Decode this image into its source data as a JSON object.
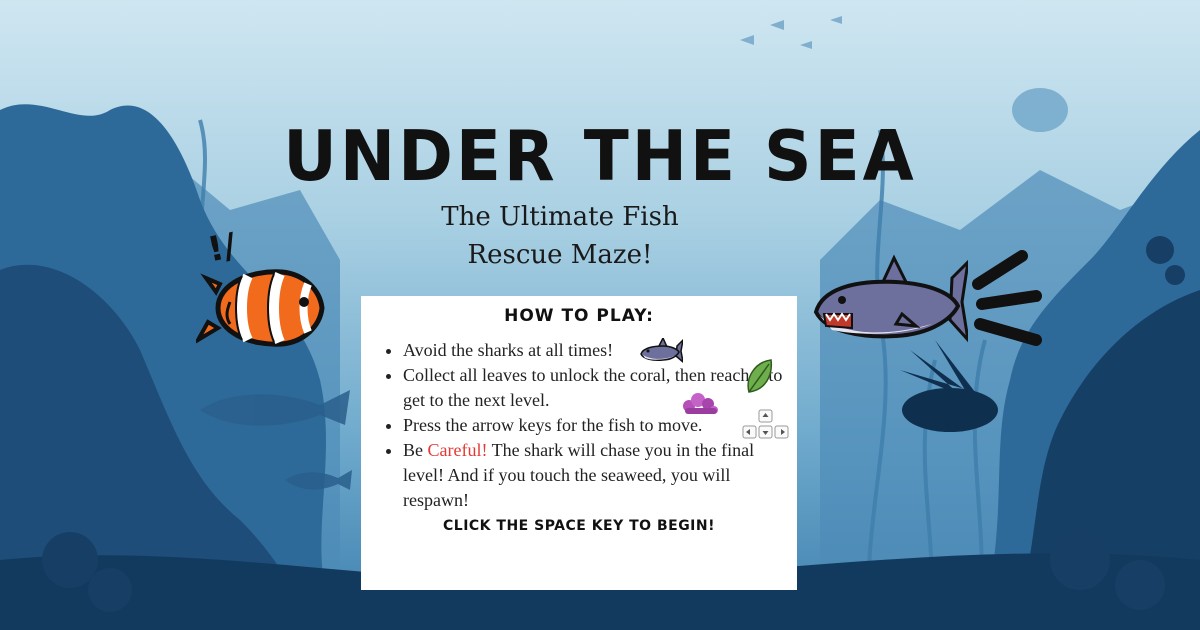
{
  "game": {
    "title": "UNDER THE SEA",
    "subtitle_line1": "The Ultimate Fish",
    "subtitle_line2": "Rescue Maze!",
    "exclamation": "!/"
  },
  "instructions": {
    "heading": "HOW TO PLAY:",
    "rule1": "Avoid the sharks at all times!",
    "rule2": "Collect all leaves to unlock the coral, then reach it to get to the next level.",
    "rule3": "Press the arrow keys for the fish to move.",
    "rule4_prefix": "Be ",
    "rule4_highlight": "Careful!",
    "rule4_rest": " The shark will chase you in the final level! And if you touch the seaweed, you will respawn!",
    "start_prompt": "CLICK THE SPACE KEY TO BEGIN!"
  },
  "colors": {
    "water_top": "#c9e3ef",
    "water_mid": "#5b9bc2",
    "water_deep": "#123a5e",
    "highlight": "#e53935",
    "clownfish": "#f26b1d"
  },
  "icons": [
    "clownfish-icon",
    "shark-icon",
    "mini-shark-icon",
    "leaf-icon",
    "coral-icon",
    "arrow-keys-icon",
    "motion-lines-icon"
  ]
}
